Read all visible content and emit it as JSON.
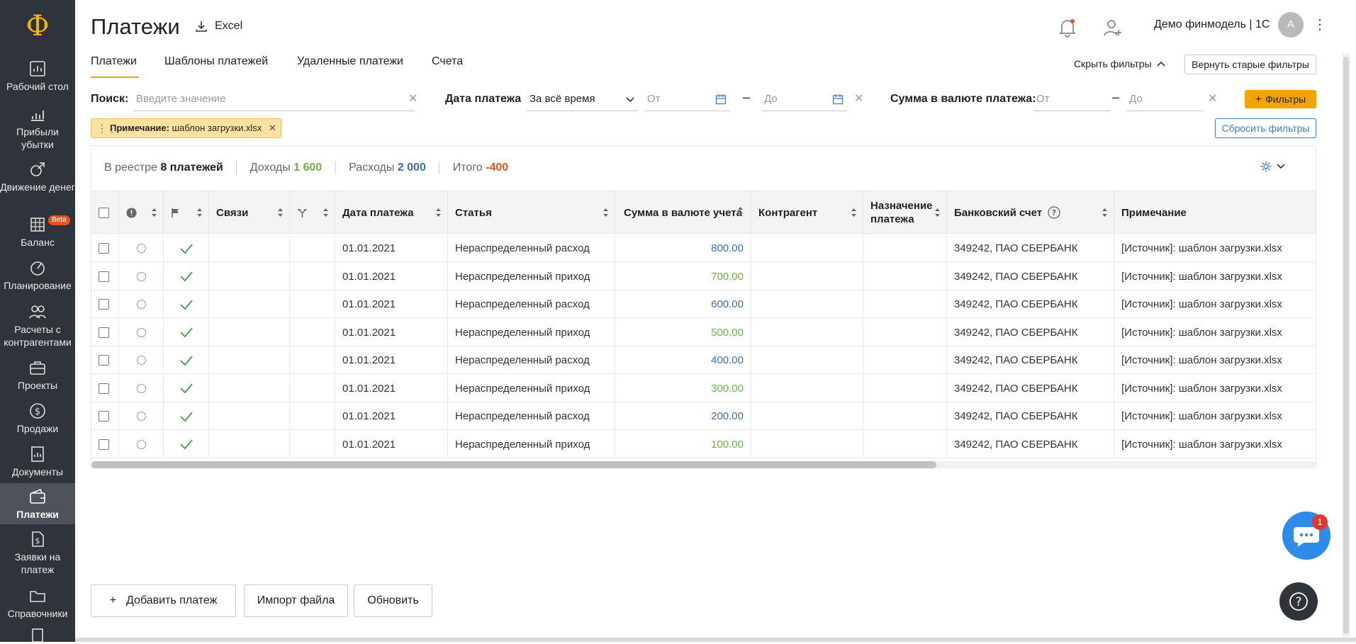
{
  "sidebar": {
    "logo": "Ф",
    "items": [
      {
        "label": "Рабочий стол",
        "icon": "dashboard-icon"
      },
      {
        "label": "Прибыли убытки",
        "icon": "bar-chart-icon"
      },
      {
        "label": "Движение денег",
        "icon": "money-flow-icon"
      },
      {
        "label": "Баланс",
        "icon": "balance-icon",
        "badge": "Beta"
      },
      {
        "label": "Планирование",
        "icon": "planning-icon"
      },
      {
        "label": "Расчеты с контрагентами",
        "icon": "contractors-icon"
      },
      {
        "label": "Проекты",
        "icon": "briefcase-icon"
      },
      {
        "label": "Продажи",
        "icon": "dollar-icon"
      },
      {
        "label": "Документы",
        "icon": "documents-icon"
      },
      {
        "label": "Платежи",
        "icon": "wallet-icon",
        "active": true
      },
      {
        "label": "Заявки на платеж",
        "icon": "payment-request-icon"
      },
      {
        "label": "Справочники",
        "icon": "folder-icon"
      }
    ]
  },
  "header": {
    "title": "Платежи",
    "excel_label": "Excel",
    "org_name": "Демо финмодель | 1С",
    "avatar_letter": "А"
  },
  "tabs": [
    {
      "label": "Платежи",
      "active": true
    },
    {
      "label": "Шаблоны платежей"
    },
    {
      "label": "Удаленные платежи"
    },
    {
      "label": "Счета"
    }
  ],
  "filters": {
    "hide_label": "Скрыть фильтры",
    "restore_label": "Вернуть старые фильтры",
    "search_label": "Поиск:",
    "search_placeholder": "Введите значение",
    "date_label": "Дата платежа",
    "date_period": "За всё время",
    "from_placeholder": "От",
    "to_placeholder": "До",
    "amount_label": "Сумма в валюте платежа:",
    "filters_button": "Фильтры",
    "reset_button": "Сбросить фильтры",
    "chip_key": "Примечание:",
    "chip_value": "шаблон загрузки.xlsx"
  },
  "summary": {
    "registry_label": "В реестре",
    "registry_value": "8 платежей",
    "income_label": "Доходы",
    "income_value": "1 600",
    "expense_label": "Расходы",
    "expense_value": "2 000",
    "total_label": "Итого",
    "total_value": "-400"
  },
  "table": {
    "columns": [
      "Связи",
      "Дата платежа",
      "Статья",
      "Сумма в валюте учета",
      "Контрагент",
      "Назначение платежа",
      "Банковский счет",
      "Примечание"
    ],
    "rows": [
      {
        "date": "01.01.2021",
        "article": "Нераспределенный расход",
        "amount": "800.00",
        "type": "expense",
        "account": "349242, ПАО СБЕРБАНК",
        "note": "[Источник]: шаблон загрузки.xlsx"
      },
      {
        "date": "01.01.2021",
        "article": "Нераспределенный приход",
        "amount": "700.00",
        "type": "income",
        "account": "349242, ПАО СБЕРБАНК",
        "note": "[Источник]: шаблон загрузки.xlsx"
      },
      {
        "date": "01.01.2021",
        "article": "Нераспределенный расход",
        "amount": "600.00",
        "type": "expense",
        "account": "349242, ПАО СБЕРБАНК",
        "note": "[Источник]: шаблон загрузки.xlsx"
      },
      {
        "date": "01.01.2021",
        "article": "Нераспределенный приход",
        "amount": "500.00",
        "type": "income",
        "account": "349242, ПАО СБЕРБАНК",
        "note": "[Источник]: шаблон загрузки.xlsx"
      },
      {
        "date": "01.01.2021",
        "article": "Нераспределенный расход",
        "amount": "400.00",
        "type": "expense",
        "account": "349242, ПАО СБЕРБАНК",
        "note": "[Источник]: шаблон загрузки.xlsx"
      },
      {
        "date": "01.01.2021",
        "article": "Нераспределенный приход",
        "amount": "300.00",
        "type": "income",
        "account": "349242, ПАО СБЕРБАНК",
        "note": "[Источник]: шаблон загрузки.xlsx"
      },
      {
        "date": "01.01.2021",
        "article": "Нераспределенный расход",
        "amount": "200.00",
        "type": "expense",
        "account": "349242, ПАО СБЕРБАНК",
        "note": "[Источник]: шаблон загрузки.xlsx"
      },
      {
        "date": "01.01.2021",
        "article": "Нераспределенный приход",
        "amount": "100.00",
        "type": "income",
        "account": "349242, ПАО СБЕРБАНК",
        "note": "[Источник]: шаблон загрузки.xlsx"
      }
    ]
  },
  "footer": {
    "add_label": "Добавить платеж",
    "import_label": "Импорт файла",
    "refresh_label": "Обновить"
  },
  "chat_badge": "1",
  "colors": {
    "accent": "#f0a500",
    "income": "#6cb33f",
    "expense": "#3b6fb6",
    "total": "#e8531b",
    "sidebar": "#2f343a"
  }
}
